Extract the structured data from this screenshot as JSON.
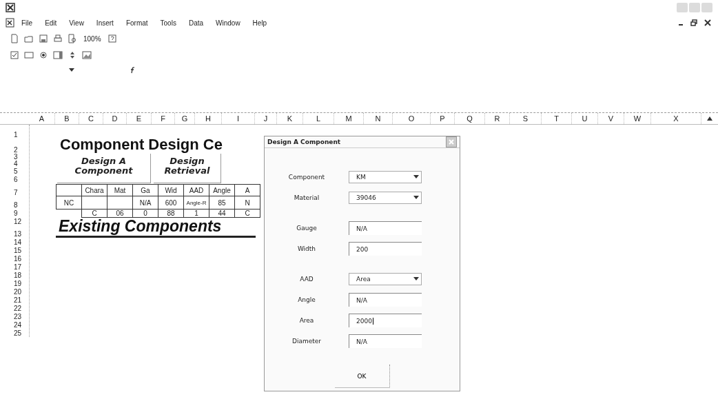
{
  "menu": [
    "File",
    "Edit",
    "View",
    "Insert",
    "Format",
    "Tools",
    "Data",
    "Window",
    "Help"
  ],
  "toolbar": {
    "zoom": "100%"
  },
  "columns": [
    "A",
    "B",
    "C",
    "D",
    "E",
    "F",
    "G",
    "H",
    "I",
    "J",
    "K",
    "L",
    "M",
    "N",
    "O",
    "P",
    "Q",
    "R",
    "S",
    "T",
    "U",
    "V",
    "W",
    "X"
  ],
  "rows": [
    "1",
    "2",
    "3",
    "4",
    "5",
    "6",
    "7",
    "8",
    "9",
    "12",
    "13",
    "14",
    "15",
    "16",
    "17",
    "18",
    "19",
    "20",
    "21",
    "22",
    "23",
    "24",
    "25"
  ],
  "sheet": {
    "title": "Component Design Ce",
    "buttons": [
      {
        "lines": [
          "Design A",
          "Component"
        ]
      },
      {
        "lines": [
          "Design",
          "Retrieval"
        ]
      }
    ],
    "table": [
      [
        {
          "kind": "blank"
        },
        {
          "kind": "text",
          "text": "Chara"
        },
        {
          "kind": "text",
          "text": "Mat"
        },
        {
          "kind": "text",
          "text": "Ga"
        },
        {
          "kind": "text",
          "text": "Wid"
        },
        {
          "kind": "text",
          "text": "AAD"
        },
        {
          "kind": "text",
          "text": "Angle"
        },
        {
          "kind": "text",
          "text": "A"
        }
      ],
      [
        {
          "kind": "text",
          "text": "NC"
        },
        {
          "kind": "blank"
        },
        {
          "kind": "blank"
        },
        {
          "kind": "text",
          "text": "N/A"
        },
        {
          "kind": "text",
          "text": "600"
        },
        {
          "kind": "text",
          "text": "Angle-R"
        },
        {
          "kind": "text",
          "text": "85"
        },
        {
          "kind": "text",
          "text": "N"
        }
      ],
      [
        {
          "kind": "none"
        },
        {
          "kind": "text",
          "text": "C"
        },
        {
          "kind": "text",
          "text": "06"
        },
        {
          "kind": "text",
          "text": "0"
        },
        {
          "kind": "text",
          "text": "88"
        },
        {
          "kind": "text",
          "text": "1"
        },
        {
          "kind": "text",
          "text": "44"
        },
        {
          "kind": "text",
          "text": "C"
        }
      ]
    ],
    "section_heading": "Existing Components"
  },
  "dialog": {
    "title": "Design A Component",
    "groups": [
      [
        {
          "label": "Component",
          "kind": "dropdown",
          "value": "KM"
        },
        {
          "label": "Material",
          "kind": "dropdown",
          "value": "39046"
        }
      ],
      [
        {
          "label": "Gauge",
          "kind": "text",
          "value": "N/A",
          "focused": false
        },
        {
          "label": "Width",
          "kind": "text",
          "value": "200",
          "focused": false
        }
      ],
      [
        {
          "label": "AAD",
          "kind": "dropdown",
          "value": "Area"
        },
        {
          "label": "Angle",
          "kind": "text",
          "value": "N/A",
          "focused": false
        },
        {
          "label": "Area",
          "kind": "text",
          "value": "2000",
          "focused": true
        },
        {
          "label": "Diameter",
          "kind": "text",
          "value": "N/A",
          "focused": false
        }
      ]
    ],
    "ok": "OK"
  }
}
